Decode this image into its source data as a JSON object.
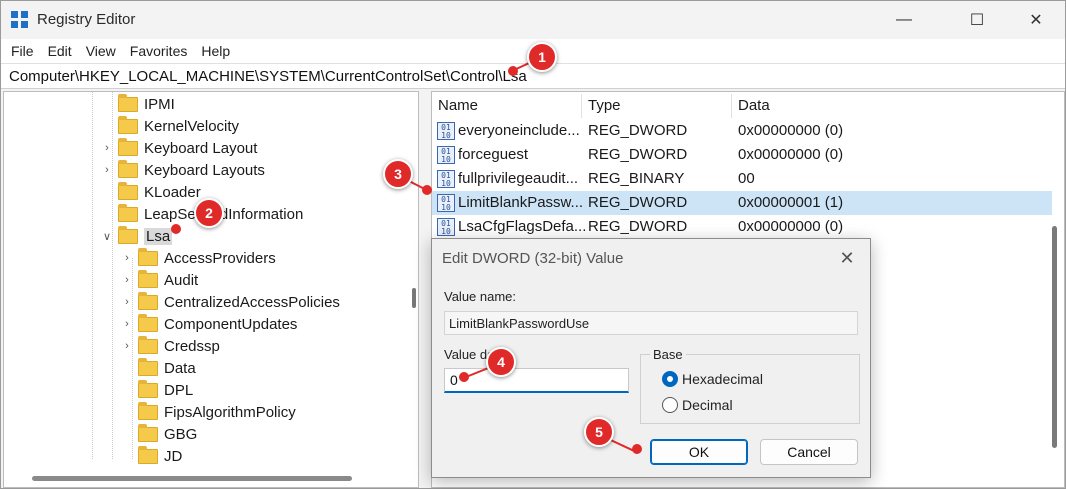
{
  "window": {
    "title": "Registry Editor",
    "controls": {
      "minimize": "—",
      "maximize": "☐",
      "close": "✕"
    }
  },
  "menu": [
    "File",
    "Edit",
    "View",
    "Favorites",
    "Help"
  ],
  "address": "Computer\\HKEY_LOCAL_MACHINE\\SYSTEM\\CurrentControlSet\\Control\\Lsa",
  "tree": {
    "items": [
      {
        "label": "IPMI",
        "expandable": false
      },
      {
        "label": "KernelVelocity",
        "expandable": false
      },
      {
        "label": "Keyboard Layout",
        "expandable": true
      },
      {
        "label": "Keyboard Layouts",
        "expandable": true
      },
      {
        "label": "KLoader",
        "expandable": false
      },
      {
        "label": "LeapSecondInformation",
        "expandable": false
      },
      {
        "label": "Lsa",
        "expandable": true,
        "expanded": true,
        "selected": true
      },
      {
        "label": "AccessProviders",
        "expandable": true
      },
      {
        "label": "Audit",
        "expandable": true
      },
      {
        "label": "CentralizedAccessPolicies",
        "expandable": true
      },
      {
        "label": "ComponentUpdates",
        "expandable": true
      },
      {
        "label": "Credssp",
        "expandable": true
      },
      {
        "label": "Data",
        "expandable": false
      },
      {
        "label": "DPL",
        "expandable": false
      },
      {
        "label": "FipsAlgorithmPolicy",
        "expandable": false
      },
      {
        "label": "GBG",
        "expandable": false
      },
      {
        "label": "JD",
        "expandable": false
      }
    ]
  },
  "list": {
    "columns": [
      "Name",
      "Type",
      "Data"
    ],
    "rows": [
      {
        "name": "everyoneinclude...",
        "type": "REG_DWORD",
        "data": "0x00000000 (0)",
        "icon": "registry-value-icon"
      },
      {
        "name": "forceguest",
        "type": "REG_DWORD",
        "data": "0x00000000 (0)",
        "icon": "registry-value-icon"
      },
      {
        "name": "fullprivilegeaudit...",
        "type": "REG_BINARY",
        "data": "00",
        "icon": "registry-value-icon"
      },
      {
        "name": "LimitBlankPassw...",
        "type": "REG_DWORD",
        "data": "0x00000001 (1)",
        "icon": "registry-value-icon",
        "selected": true
      },
      {
        "name": "LsaCfgFlagsDefa...",
        "type": "REG_DWORD",
        "data": "0x00000000 (0)",
        "icon": "registry-value-icon"
      }
    ]
  },
  "dialog": {
    "title": "Edit DWORD (32-bit) Value",
    "value_name_label": "Value name:",
    "value_name": "LimitBlankPasswordUse",
    "value_data_label": "Value data:",
    "value_data": "0",
    "base_label": "Base",
    "base_options": [
      "Hexadecimal",
      "Decimal"
    ],
    "base_selected": "Hexadecimal",
    "ok_label": "OK",
    "cancel_label": "Cancel",
    "close_glyph": "✕"
  },
  "annotations": [
    "1",
    "2",
    "3",
    "4",
    "5"
  ],
  "colors": {
    "annotation": "#e02a2a",
    "accent": "#0067c0",
    "selection": "#cde4f7"
  }
}
